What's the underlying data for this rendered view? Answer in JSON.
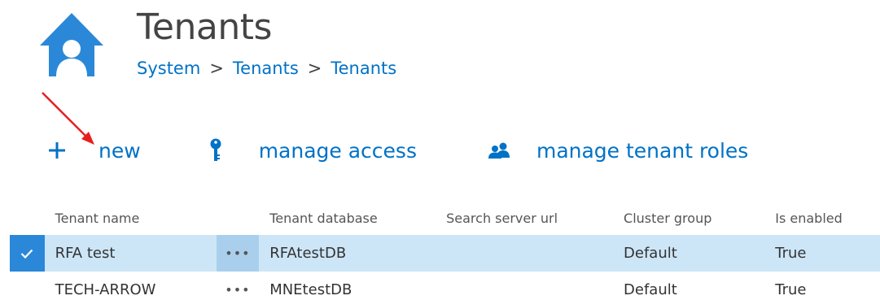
{
  "page": {
    "title": "Tenants",
    "breadcrumb": [
      "System",
      ">",
      "Tenants",
      ">",
      "Tenants"
    ]
  },
  "toolbar": {
    "new_label": "new",
    "manage_access_label": "manage access",
    "manage_tenant_roles_label": "manage tenant roles",
    "new_icon": "plus-icon",
    "manage_access_icon": "key-icon",
    "manage_roles_icon": "users-icon"
  },
  "grid": {
    "columns": [
      "Tenant name",
      "Tenant database",
      "Search server url",
      "Cluster group",
      "Is enabled"
    ],
    "rows": [
      {
        "selected": true,
        "name": "RFA test",
        "menu": "•••",
        "database": "RFAtestDB",
        "search_url": "",
        "cluster": "Default",
        "enabled": "True"
      },
      {
        "selected": false,
        "name": "TECH-ARROW",
        "menu": "•••",
        "database": "MNEtestDB",
        "search_url": "",
        "cluster": "Default",
        "enabled": "True"
      }
    ]
  },
  "colors": {
    "accent": "#0072c6",
    "selected_row": "#cde6f7",
    "check_box": "#2b88d8",
    "annotation_arrow": "#e81e1e"
  }
}
